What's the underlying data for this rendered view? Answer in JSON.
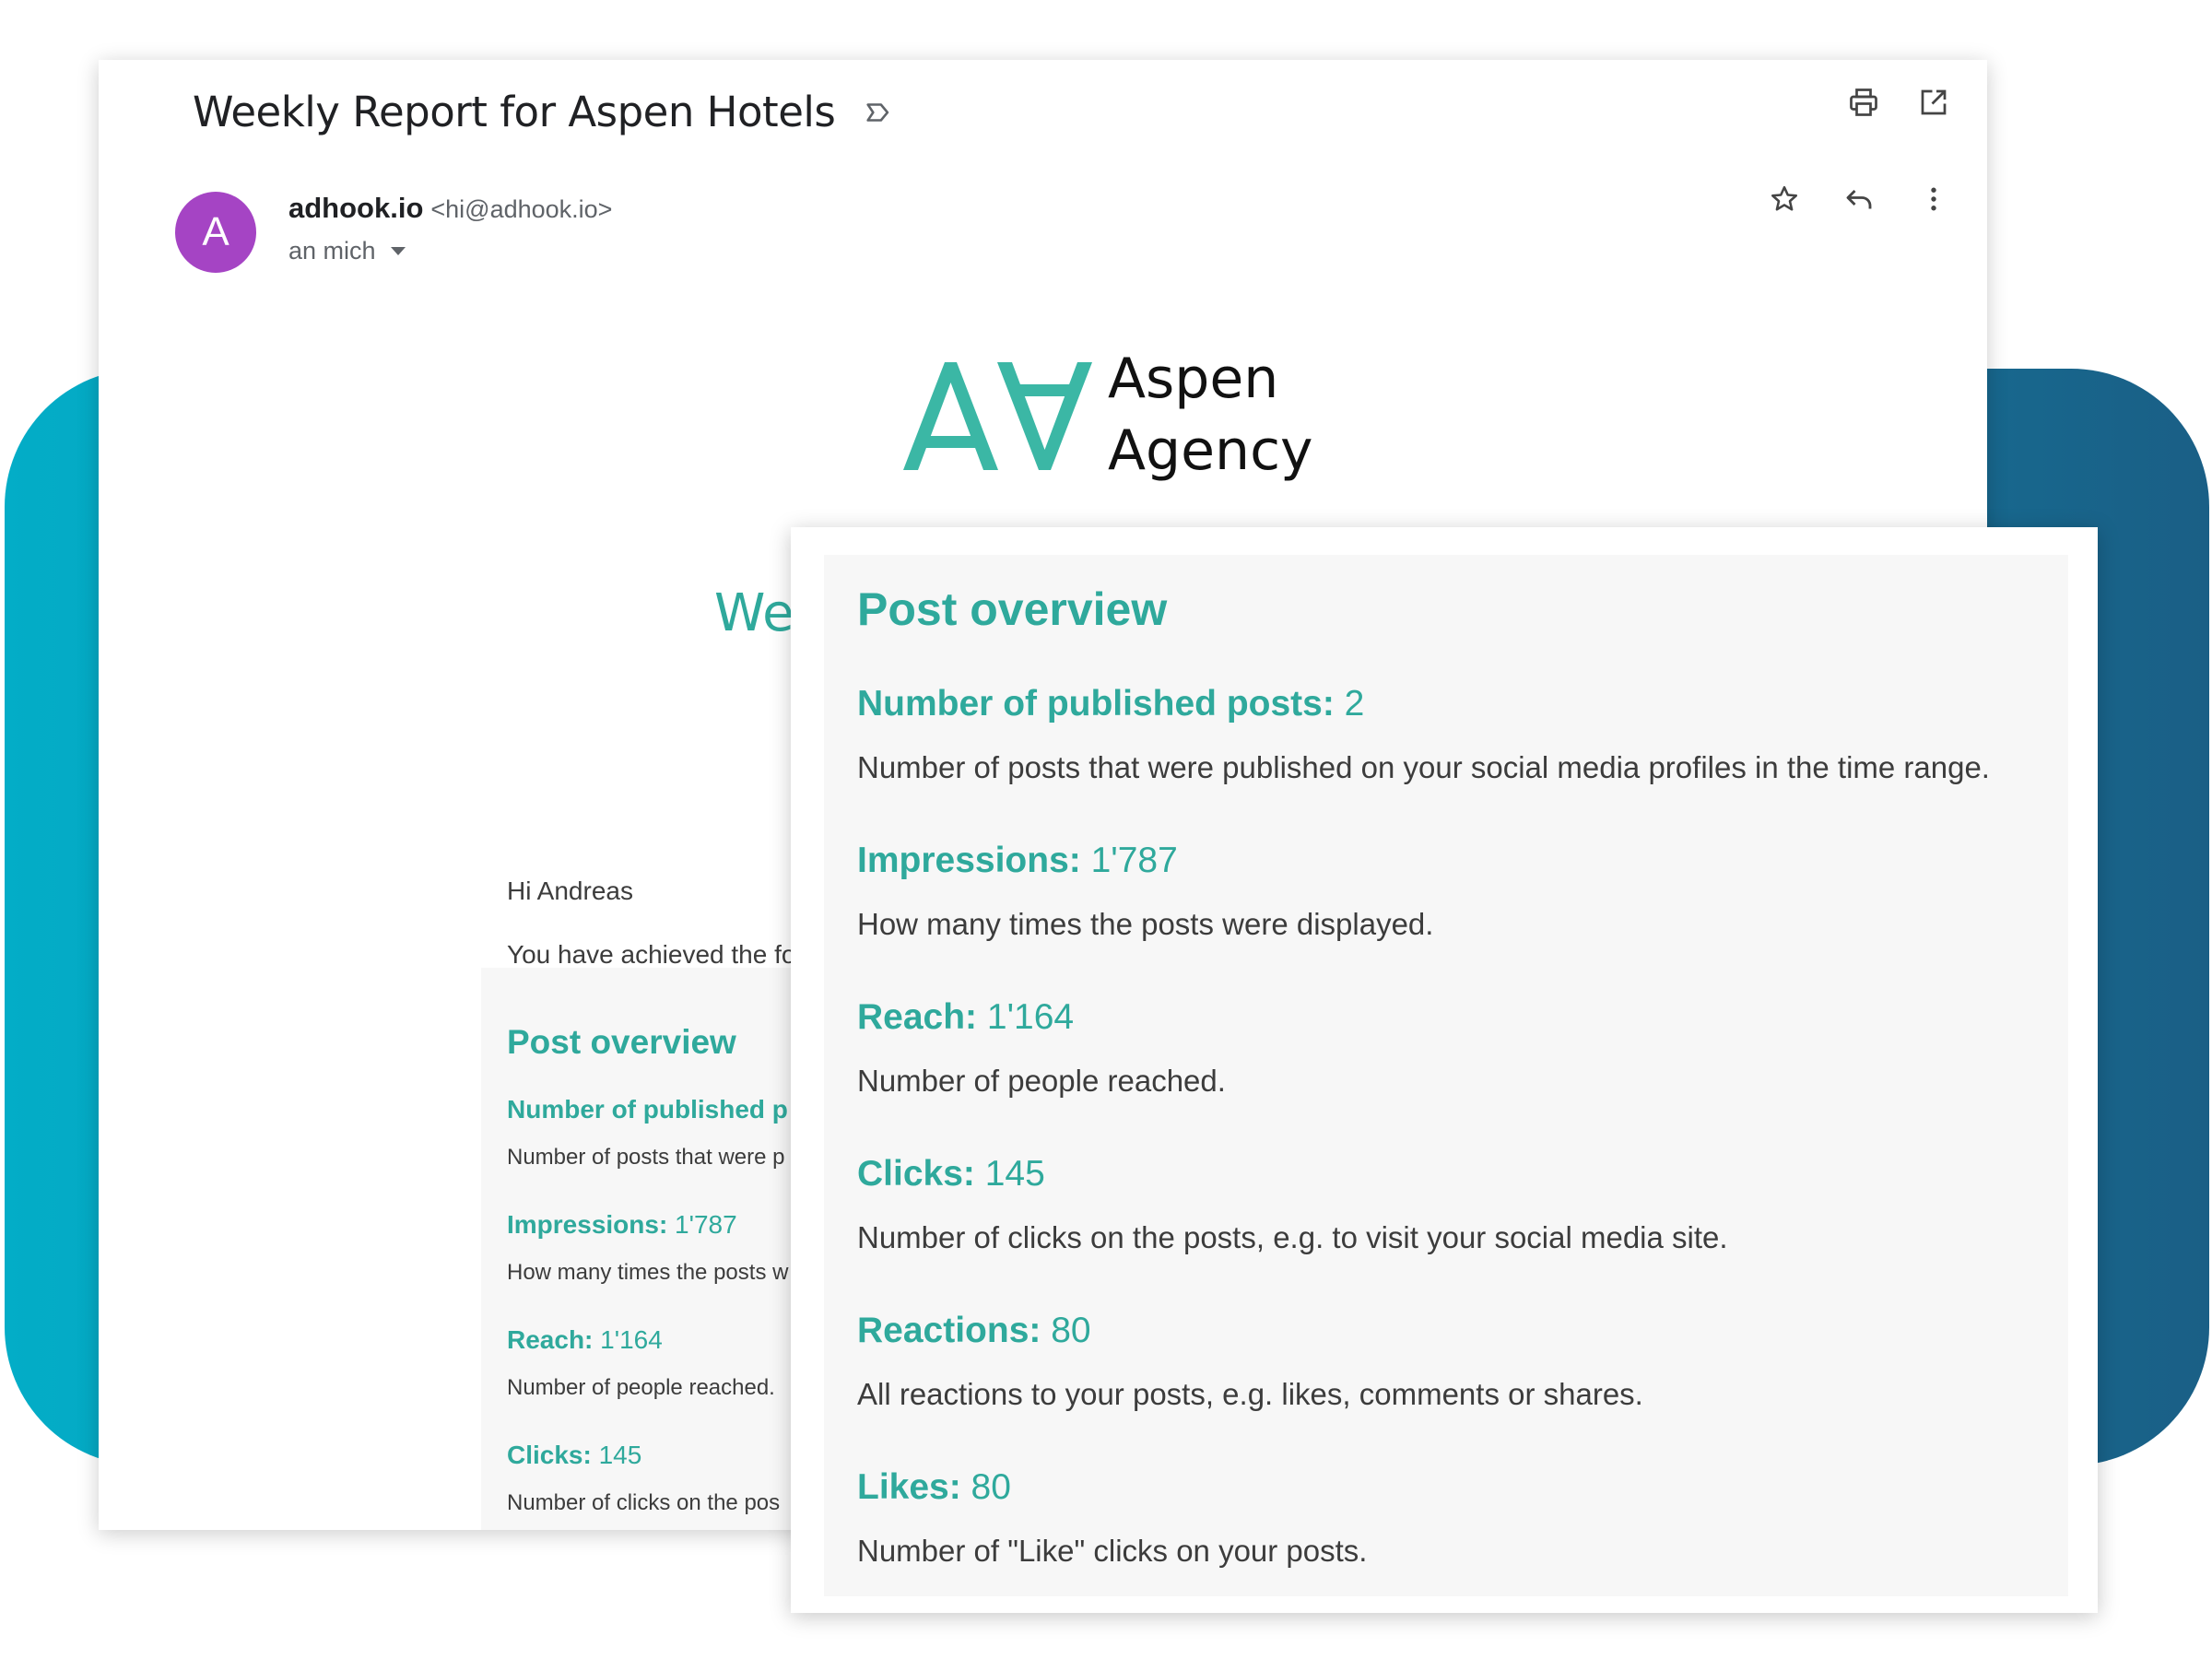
{
  "email": {
    "subject": "Weekly Report for Aspen Hotels",
    "avatar_letter": "A",
    "sender_name": "adhook.io",
    "sender_email": "<hi@adhook.io>",
    "recipient": "an mich"
  },
  "logo": {
    "line1": "Aspen",
    "line2": "Agency",
    "color": "#3bb7a5"
  },
  "body": {
    "title_partial": "We",
    "greeting": "Hi Andreas",
    "intro_partial": "You have achieved the fo"
  },
  "small_overview": {
    "title": "Post overview",
    "items": [
      {
        "label": "Number of published p",
        "value": "",
        "desc": "Number of posts that were p"
      },
      {
        "label": "Impressions:",
        "value": " 1'787",
        "desc": "How many times the posts w"
      },
      {
        "label": "Reach:",
        "value": " 1'164",
        "desc": "Number of people reached."
      },
      {
        "label": "Clicks:",
        "value": " 145",
        "desc": "Number of clicks on the pos"
      }
    ]
  },
  "post_overview": {
    "title": "Post overview",
    "items": [
      {
        "label": "Number of published posts:",
        "value": " 2",
        "desc": "Number of posts that were published on your social media profiles in the time range."
      },
      {
        "label": "Impressions:",
        "value": " 1'787",
        "desc": "How many times the posts were displayed."
      },
      {
        "label": "Reach:",
        "value": " 1'164",
        "desc": "Number of people reached."
      },
      {
        "label": "Clicks:",
        "value": " 145",
        "desc": "Number of clicks on the posts, e.g. to visit your social media site."
      },
      {
        "label": "Reactions:",
        "value": " 80",
        "desc": "All reactions to your posts, e.g. likes, comments or shares."
      },
      {
        "label": "Likes:",
        "value": " 80",
        "desc": "Number of \"Like\" clicks on your posts."
      }
    ]
  },
  "colors": {
    "accent_teal": "#2fa99c",
    "avatar_purple": "#a544c4",
    "band_left": "#03adc7",
    "band_right": "#1a5f86"
  }
}
